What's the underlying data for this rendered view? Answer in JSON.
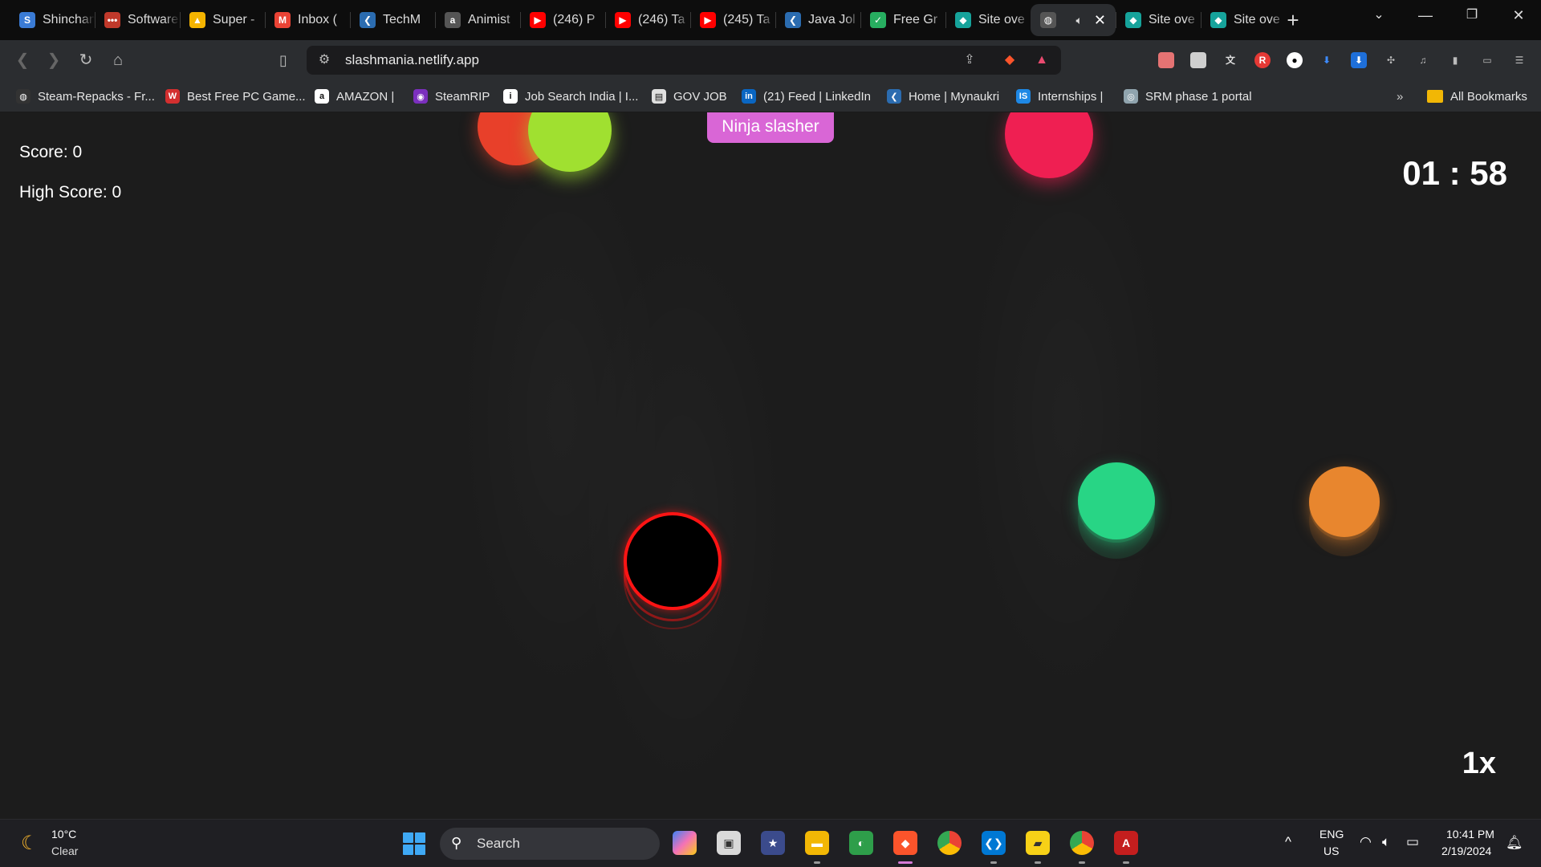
{
  "browser": {
    "tabs": [
      {
        "title": "Shinchan",
        "color": "#3a7bd5",
        "glyph": "S"
      },
      {
        "title": "Software",
        "color": "#c0392b",
        "glyph": "•••"
      },
      {
        "title": "Super -",
        "color": "#f4b400",
        "glyph": "▲"
      },
      {
        "title": "Inbox (",
        "color": "#ea4335",
        "glyph": "M"
      },
      {
        "title": "TechM",
        "color": "#2b6cb0",
        "glyph": "❮"
      },
      {
        "title": "Animist",
        "color": "#555555",
        "glyph": "a"
      },
      {
        "title": "(246) P",
        "color": "#ff0000",
        "glyph": "▶"
      },
      {
        "title": "(246) Ta",
        "color": "#ff0000",
        "glyph": "▶"
      },
      {
        "title": "(245) Ta",
        "color": "#ff0000",
        "glyph": "▶"
      },
      {
        "title": "Java Jol",
        "color": "#2b6cb0",
        "glyph": "❮"
      },
      {
        "title": "Free Gr",
        "color": "#27ae60",
        "glyph": "✓"
      },
      {
        "title": "Site ove",
        "color": "#16a39b",
        "glyph": "◆"
      },
      {
        "title": "",
        "color": "#555555",
        "glyph": "◍",
        "active": true
      },
      {
        "title": "Site ove",
        "color": "#16a39b",
        "glyph": "◆"
      },
      {
        "title": "Site ove",
        "color": "#16a39b",
        "glyph": "◆"
      }
    ],
    "url": "slashmania.netlify.app",
    "bookmarks": [
      {
        "label": "Steam-Repacks - Fr...",
        "color": "#333333",
        "glyph": "◍"
      },
      {
        "label": "Best Free PC Game...",
        "color": "#d32f2f",
        "glyph": "W"
      },
      {
        "label": "AMAZON |",
        "color": "#ffffff",
        "glyph": "a"
      },
      {
        "label": "SteamRIP",
        "color": "#7b2fbe",
        "glyph": "◉"
      },
      {
        "label": "Job Search India | I...",
        "color": "#ffffff",
        "glyph": "i"
      },
      {
        "label": "GOV JOB",
        "color": "#e0e0e0",
        "glyph": "▤"
      },
      {
        "label": "(21) Feed | LinkedIn",
        "color": "#0a66c2",
        "glyph": "in"
      },
      {
        "label": "Home | Mynaukri",
        "color": "#2b6cb0",
        "glyph": "❮"
      },
      {
        "label": "Internships |",
        "color": "#1e88e5",
        "glyph": "IS"
      },
      {
        "label": "SRM phase 1 portal",
        "color": "#90a4ae",
        "glyph": "◎"
      }
    ],
    "all_bookmarks": "All Bookmarks"
  },
  "game": {
    "title_badge": "Ninja slasher",
    "score": "Score: 0",
    "high_score": "High Score: 0",
    "timer": "01 : 58",
    "speed": "1x"
  },
  "taskbar": {
    "weather_temp": "10°C",
    "weather_cond": "Clear",
    "search": "Search",
    "lang": "ENG",
    "region": "US",
    "time": "10:41 PM",
    "date": "2/19/2024"
  }
}
